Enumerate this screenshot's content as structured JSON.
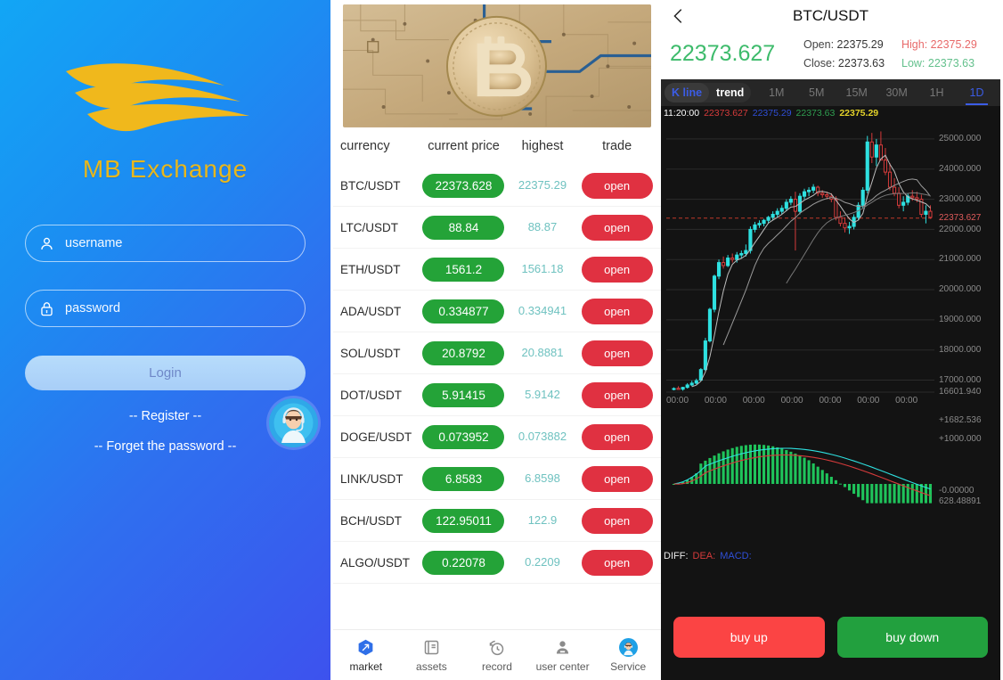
{
  "login": {
    "brand_name": "MB  Exchange",
    "brand_color": "#e8b71c",
    "username_placeholder": "username",
    "password_placeholder": "password",
    "username_value": "",
    "password_value": "",
    "login_label": "Login",
    "register_label": "-- Register --",
    "forget_label": "-- Forget the password --",
    "service_icon": "headset-avatar-icon"
  },
  "market": {
    "banner_alt": "bitcoin-circuit-banner",
    "columns": [
      "currency",
      "current price",
      "highest",
      "trade"
    ],
    "rows": [
      {
        "pair": "BTC/USDT",
        "price": "22373.628",
        "highest": "22375.29",
        "action": "open"
      },
      {
        "pair": "LTC/USDT",
        "price": "88.84",
        "highest": "88.87",
        "action": "open"
      },
      {
        "pair": "ETH/USDT",
        "price": "1561.2",
        "highest": "1561.18",
        "action": "open"
      },
      {
        "pair": "ADA/USDT",
        "price": "0.334877",
        "highest": "0.334941",
        "action": "open"
      },
      {
        "pair": "SOL/USDT",
        "price": "20.8792",
        "highest": "20.8881",
        "action": "open"
      },
      {
        "pair": "DOT/USDT",
        "price": "5.91415",
        "highest": "5.9142",
        "action": "open"
      },
      {
        "pair": "DOGE/USDT",
        "price": "0.073952",
        "highest": "0.073882",
        "action": "open"
      },
      {
        "pair": "LINK/USDT",
        "price": "6.8583",
        "highest": "6.8598",
        "action": "open"
      },
      {
        "pair": "BCH/USDT",
        "price": "122.95011",
        "highest": "122.9",
        "action": "open"
      },
      {
        "pair": "ALGO/USDT",
        "price": "0.22078",
        "highest": "0.2209",
        "action": "open"
      }
    ],
    "price_pill_color": "#24a338",
    "open_button_color": "#e03141",
    "highest_color": "#6fc2c0",
    "tabs": [
      {
        "label": "market",
        "icon": "market-compass-icon",
        "active": true
      },
      {
        "label": "assets",
        "icon": "wallet-icon",
        "active": false
      },
      {
        "label": "record",
        "icon": "record-clock-icon",
        "active": false
      },
      {
        "label": "user center",
        "icon": "user-icon",
        "active": false
      },
      {
        "label": "Service",
        "icon": "headset-avatar-icon",
        "active": false
      }
    ]
  },
  "chart": {
    "back_icon": "chevron-left-icon",
    "title": "BTC/USDT",
    "last_price": "22373.627",
    "last_price_color": "#3dbb6b",
    "open_label": "Open:",
    "open_value": "22375.29",
    "high_label": "High:",
    "high_value": "22375.29",
    "close_label": "Close:",
    "close_value": "22373.63",
    "low_label": "Low:",
    "low_value": "22373.63",
    "mode_kline": "K line",
    "mode_trend": "trend",
    "timeframes": [
      "1M",
      "5M",
      "15M",
      "30M",
      "1H",
      "1D"
    ],
    "active_timeframe": "1D",
    "crosshair": {
      "time": "11:20:00",
      "open": "22373.627",
      "high": "22375.29",
      "low": "22373.63",
      "close": "22375.29"
    },
    "indicator_labels": {
      "diff": "DIFF:",
      "dea": "DEA:",
      "macd": "MACD:"
    },
    "buy_up_label": "buy up",
    "buy_down_label": "buy down",
    "buy_up_color": "#fb4444",
    "buy_down_color": "#22a03e"
  },
  "chart_data": {
    "type": "line",
    "title": "BTC/USDT",
    "xlabel": "",
    "ylabel": "",
    "grid": true,
    "legend_position": "top",
    "price_axis_ticks": [
      "25000.000",
      "24000.000",
      "23000.000",
      "22373.627",
      "22000.000",
      "21000.000",
      "20000.000",
      "19000.000",
      "18000.000",
      "17000.000",
      "16601.940"
    ],
    "price_axis_current": "22373.627",
    "ylim": [
      16601.94,
      25500.0
    ],
    "x_ticks": [
      "00:00",
      "00:00",
      "00:00",
      "00:00",
      "00:00",
      "00:00",
      "00:00"
    ],
    "macd_axis_ticks": [
      "+1682.536",
      "+1000.000",
      "-0.00000",
      "628.48891"
    ],
    "macd_ylim": [
      -628.48891,
      1682.536
    ],
    "series": [
      {
        "name": "candles",
        "type": "candlestick",
        "up_color": "#2ee0e0",
        "down_color": "#d63b3b",
        "values": [
          [
            16700,
            16760,
            16660,
            16720
          ],
          [
            16730,
            16800,
            16680,
            16690
          ],
          [
            16700,
            16780,
            16650,
            16760
          ],
          [
            16760,
            16900,
            16720,
            16840
          ],
          [
            16840,
            16980,
            16800,
            16900
          ],
          [
            16900,
            17050,
            16860,
            16980
          ],
          [
            17000,
            17400,
            16960,
            17350
          ],
          [
            17350,
            18400,
            17300,
            18300
          ],
          [
            18300,
            19400,
            18250,
            19350
          ],
          [
            19350,
            20500,
            19250,
            20450
          ],
          [
            20450,
            21000,
            20350,
            20900
          ],
          [
            20900,
            21100,
            20700,
            20800
          ],
          [
            20800,
            21150,
            20750,
            21050
          ],
          [
            21050,
            21200,
            20900,
            21000
          ],
          [
            21000,
            21250,
            20900,
            21150
          ],
          [
            21150,
            21300,
            21050,
            21200
          ],
          [
            21200,
            21500,
            21100,
            21300
          ],
          [
            21300,
            22100,
            21200,
            22000
          ],
          [
            22000,
            22250,
            21900,
            22150
          ],
          [
            22150,
            22300,
            22050,
            22200
          ],
          [
            22200,
            22350,
            22100,
            22300
          ],
          [
            22300,
            22450,
            22200,
            22400
          ],
          [
            22400,
            22600,
            22300,
            22500
          ],
          [
            22500,
            22700,
            22400,
            22600
          ],
          [
            22600,
            22800,
            22500,
            22700
          ],
          [
            22700,
            23000,
            22600,
            22900
          ],
          [
            22900,
            23100,
            22800,
            23000
          ],
          [
            23000,
            23250,
            21300,
            22600
          ],
          [
            22600,
            23200,
            22500,
            23100
          ],
          [
            23100,
            23350,
            23000,
            23250
          ],
          [
            23250,
            23400,
            23100,
            23300
          ],
          [
            23300,
            23500,
            23200,
            23400
          ],
          [
            23400,
            23450,
            23100,
            23200
          ],
          [
            23200,
            23300,
            23050,
            23150
          ],
          [
            23150,
            23250,
            23000,
            23100
          ],
          [
            23100,
            23200,
            22900,
            23000
          ],
          [
            23000,
            23100,
            22300,
            22400
          ],
          [
            22400,
            22600,
            22100,
            22200
          ],
          [
            22200,
            22400,
            21900,
            22050
          ],
          [
            22050,
            22250,
            21850,
            22100
          ],
          [
            22100,
            22500,
            22000,
            22400
          ],
          [
            22400,
            22900,
            22300,
            22800
          ],
          [
            22800,
            23400,
            22700,
            23300
          ],
          [
            23300,
            25100,
            23200,
            24900
          ],
          [
            24900,
            25200,
            24200,
            24400
          ],
          [
            24400,
            25000,
            24100,
            24800
          ],
          [
            24800,
            25250,
            24700,
            24300
          ],
          [
            24300,
            24700,
            23800,
            23900
          ],
          [
            23900,
            24200,
            23300,
            23400
          ],
          [
            23400,
            23700,
            23100,
            23200
          ],
          [
            23200,
            23400,
            22700,
            22800
          ],
          [
            22800,
            23100,
            22600,
            22900
          ],
          [
            22900,
            23200,
            22800,
            23100
          ],
          [
            23100,
            23300,
            22950,
            23050
          ],
          [
            23050,
            23250,
            22900,
            23000
          ],
          [
            23000,
            23150,
            22400,
            22500
          ],
          [
            22500,
            22800,
            22200,
            22600
          ],
          [
            22600,
            22800,
            22350,
            22400
          ]
        ]
      },
      {
        "name": "MA-short",
        "type": "line",
        "color": "#bdbdbd"
      },
      {
        "name": "MA-mid",
        "type": "line",
        "color": "#9a9a9a"
      },
      {
        "name": "MA-long",
        "type": "line",
        "color": "#777777"
      }
    ],
    "macd_series": [
      {
        "name": "DIFF",
        "type": "line",
        "color": "#2ee0e0"
      },
      {
        "name": "DEA",
        "type": "line",
        "color": "#d63b3b"
      },
      {
        "name": "MACD",
        "type": "bar",
        "color": "#1fc45b"
      }
    ]
  }
}
